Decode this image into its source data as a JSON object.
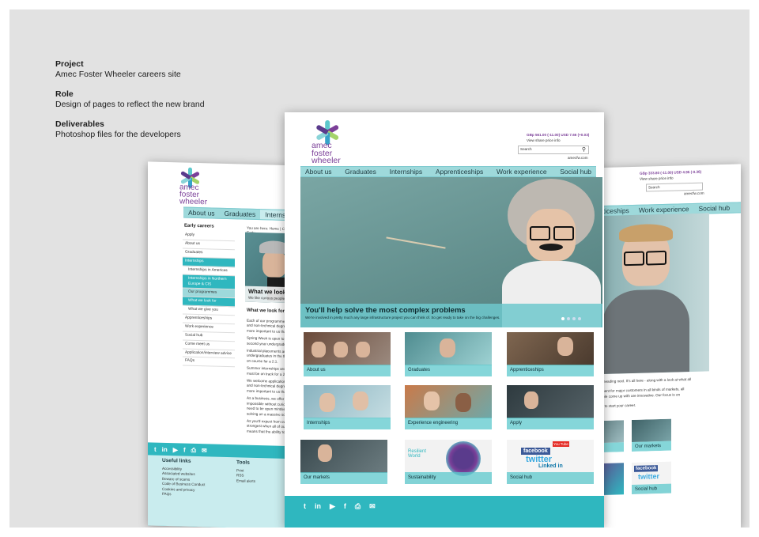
{
  "caption": {
    "project_heading": "Project",
    "project_text": "Amec Foster Wheeler careers site",
    "role_heading": "Role",
    "role_text": "Design of pages to reflect the new brand",
    "deliverables_heading": "Deliverables",
    "deliverables_text": "Photoshop files for the developers"
  },
  "brand": {
    "logo_line1": "amec",
    "logo_line2": "foster",
    "logo_line3": "wheeler",
    "accent": "#5cc8cc",
    "purple": "#7b3f98"
  },
  "center": {
    "share_price": "GBp 561.00 (-11.00) USD 7.66 (+0.03)",
    "share_link": "View share price info",
    "search_placeholder": "Search",
    "site_link": "amecfw.com",
    "nav": [
      "About us",
      "Graduates",
      "Internships",
      "Apprenticeships",
      "Work experience",
      "Social hub"
    ],
    "hero_title": "You'll help solve the most complex problems",
    "hero_sub": "We're involved in pretty much any large infrastructure project you can think of. So get ready to take on the big challenges.",
    "tiles": [
      "About us",
      "Graduates",
      "Apprenticeships",
      "Internships",
      "Experience engineering",
      "Apply",
      "Our markets",
      "Sustainability",
      "Social hub"
    ],
    "resilient": "Resilient World",
    "social_facebook": "facebook",
    "social_twitter": "twitter",
    "social_linkedin": "Linked in",
    "social_youtube": "You Tube"
  },
  "left": {
    "nav": [
      "About us",
      "Graduates",
      "Internships"
    ],
    "breadcrumb": "You are here: Home | Careers | Early",
    "sidebar_title": "Early careers",
    "sidebar_items": [
      "Apply",
      "About us",
      "Graduates",
      "Internships",
      "Internships in Americas",
      "Internships in Northern Europe & CIS",
      "Our programmes",
      "What we look for",
      "What we give you",
      "Apprenticeships",
      "Work experience",
      "Social hub",
      "Come meet us",
      "Application/interview advice",
      "FAQs"
    ],
    "hero_caption": "What we look",
    "hero_caption_sub": "We like curious people who",
    "body_heading": "What we look for",
    "body_lines": [
      "Each of our programmes has be",
      "and non-technical degree discip",
      "more important to us than what",
      "Spring Week is open to those in",
      "second year undergraduates on",
      "Industrial placements are ope",
      "undergraduates in the third year",
      "on course for a 2:1.",
      "Summer internships are for u",
      "must be on track for a 2:1.",
      "We welcome applications from u",
      "and non-technical degree discip",
      "more important to us than what",
      "As a business, we offer clever w",
      "impossible without curiosity, wh",
      "need to be open minded, eager",
      "solving on a massive scale.",
      "As you'd expect from our 'conne",
      "strongest when all of our people",
      "means that the ability to work w"
    ],
    "useful_links_title": "Useful links",
    "useful_links": [
      "Accessibility",
      "Associated websites",
      "Beware of scams",
      "Code of Business Conduct",
      "Cookies and privacy",
      "FAQs"
    ],
    "tools_title": "Tools",
    "tools": [
      "Print",
      "RSS",
      "Email alerts"
    ]
  },
  "right": {
    "share_price": "GBp 333.80 (-11.00) USD 4.95 (-0.36)",
    "share_link": "View share price info",
    "search_placeholder": "Search",
    "site_link": "amecfw.com",
    "nav": [
      "pprenticeships",
      "Work experience",
      "Social hub"
    ],
    "text_lines": [
      "where we're heading next. It's all here - along with a look at what all",
      "s and equipment for major customers in all kinds of markets, all",
      "ions our people come up with are innovative. Our focus is on",
      "place for you to start your career."
    ],
    "tiles": [
      "ork",
      "Our markets",
      "Social hub"
    ]
  }
}
